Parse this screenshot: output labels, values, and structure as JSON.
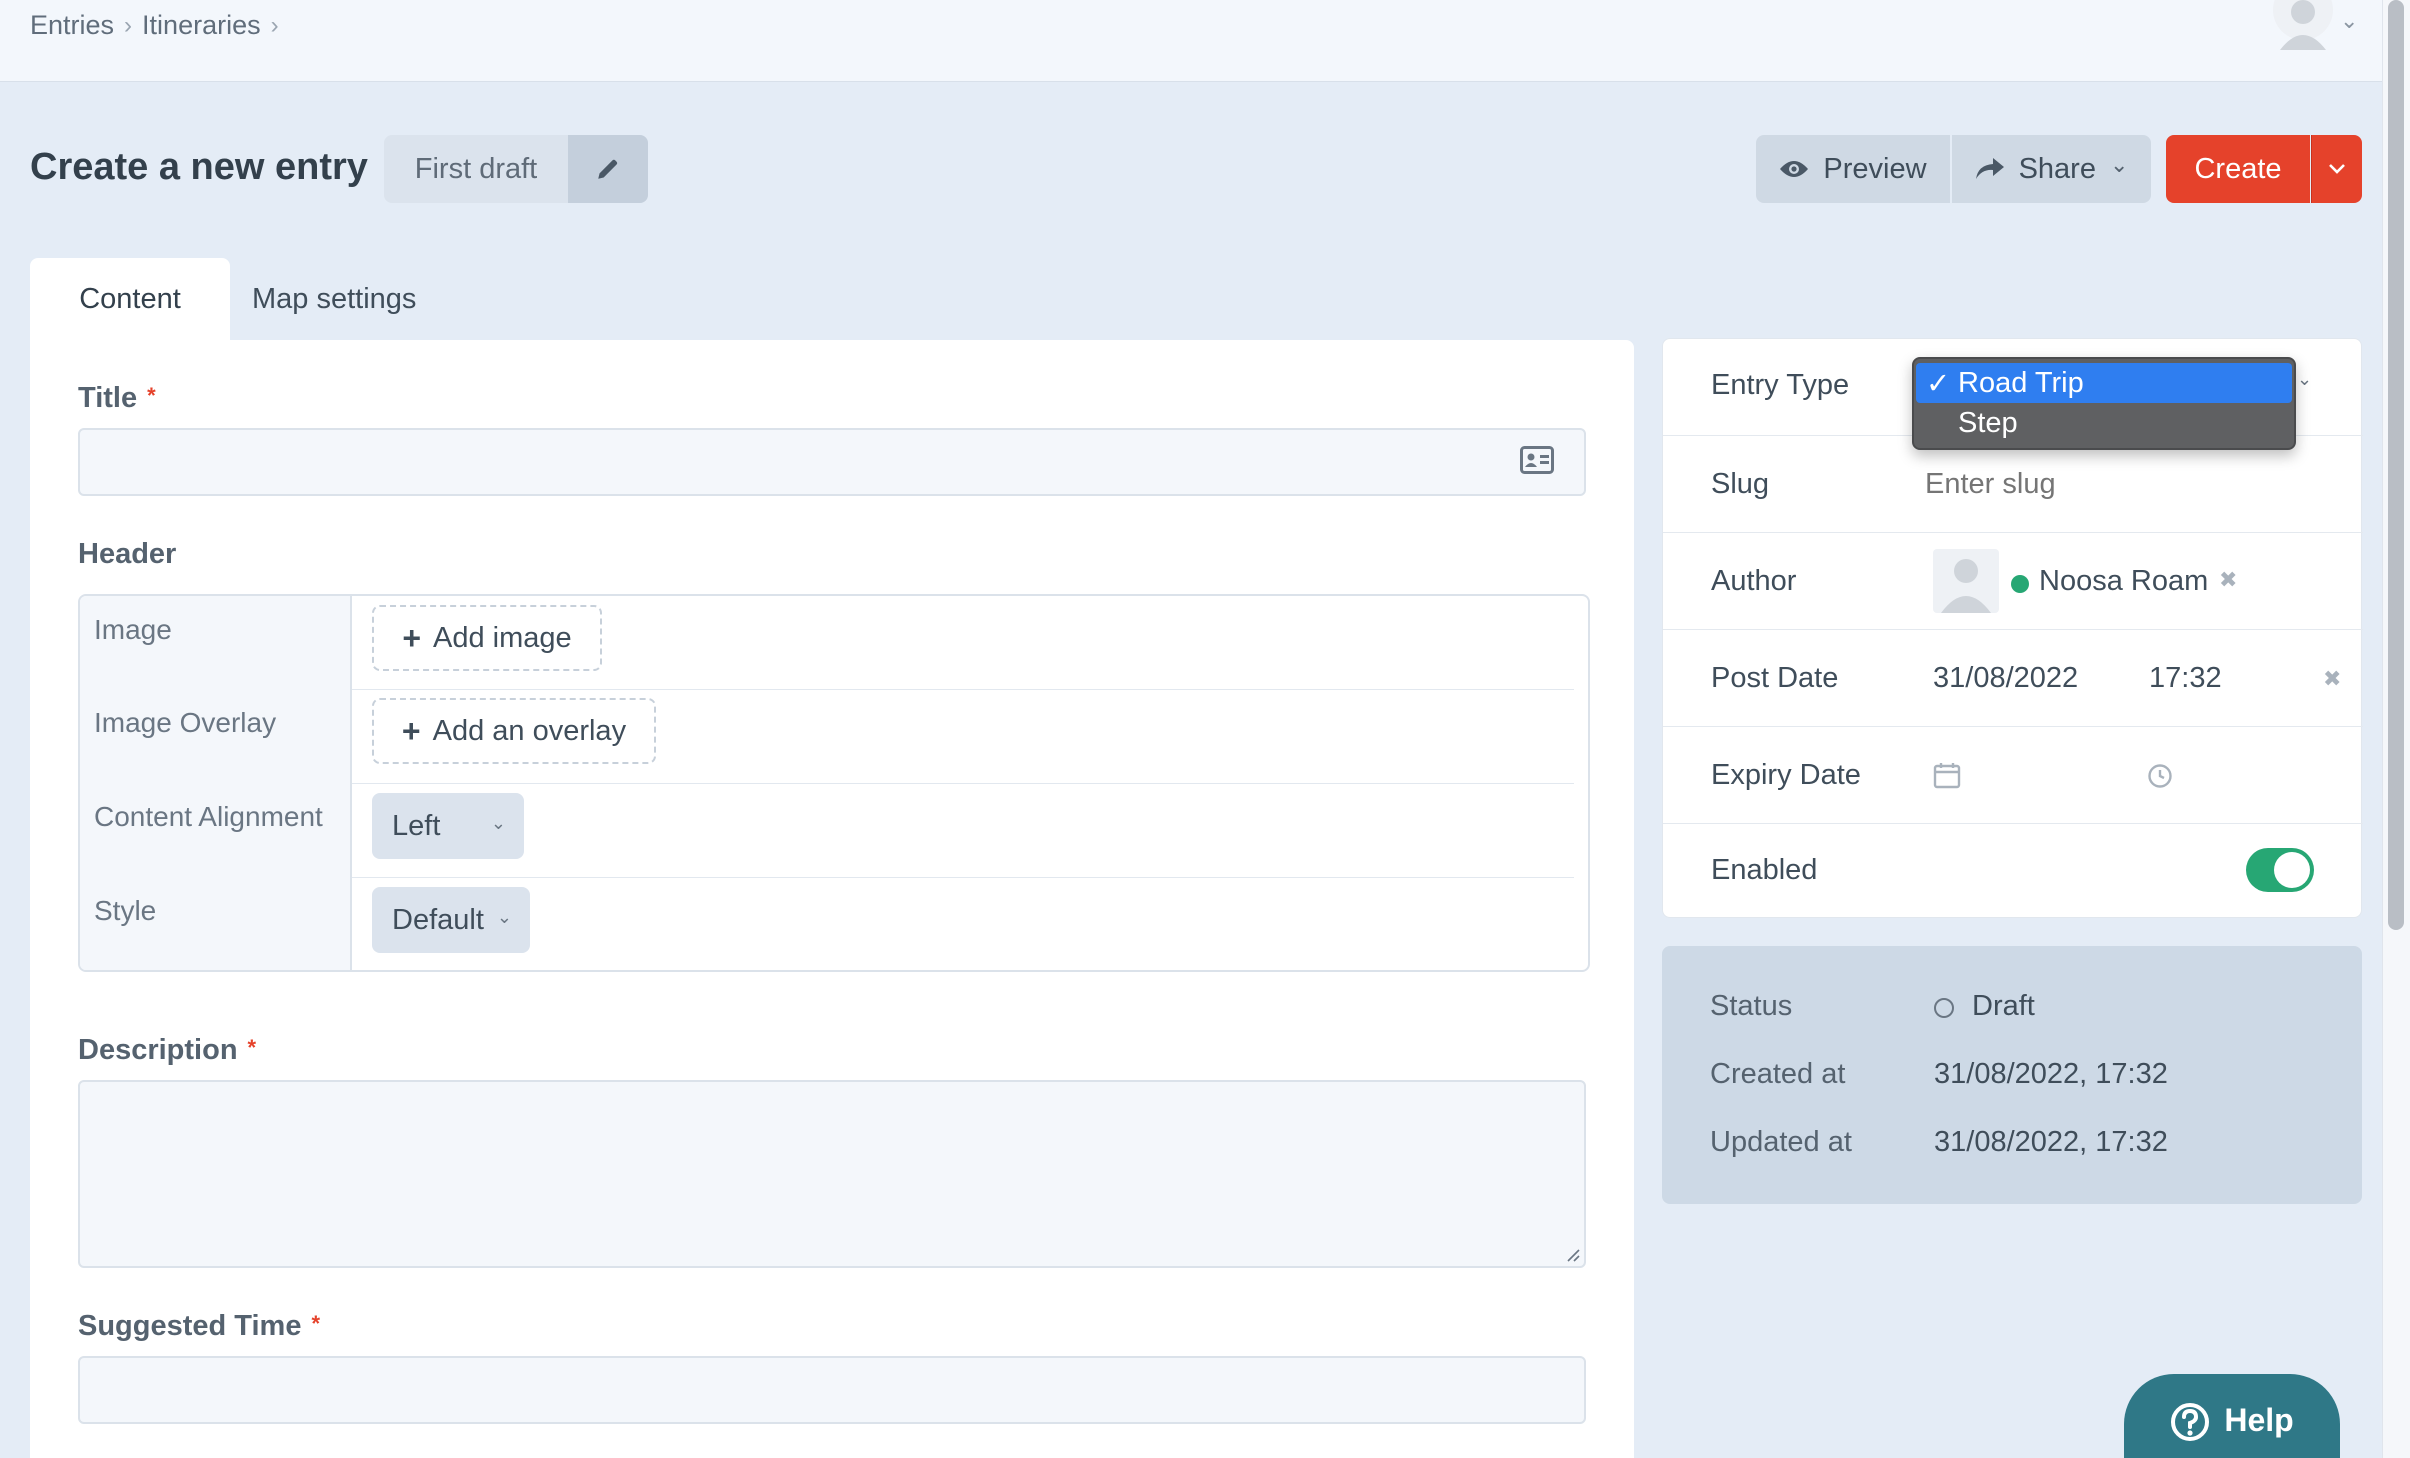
{
  "breadcrumb": [
    "Entries",
    "Itineraries"
  ],
  "page": {
    "title": "Create a new entry",
    "draft_name": "First draft"
  },
  "actions": {
    "preview": "Preview",
    "share": "Share",
    "create": "Create"
  },
  "tabs": [
    {
      "label": "Content",
      "active": true
    },
    {
      "label": "Map settings",
      "active": false
    }
  ],
  "fields": {
    "title": {
      "label": "Title",
      "required": "*",
      "value": ""
    },
    "header": {
      "label": "Header",
      "rows": [
        {
          "label": "Image",
          "control": "Add image"
        },
        {
          "label": "Image Overlay",
          "control": "Add an overlay"
        },
        {
          "label": "Content Alignment",
          "control": "Left"
        },
        {
          "label": "Style",
          "control": "Default"
        }
      ]
    },
    "description": {
      "label": "Description",
      "required": "*",
      "value": ""
    },
    "suggested_time": {
      "label": "Suggested Time",
      "required": "*",
      "value": ""
    }
  },
  "meta": {
    "entry_type": {
      "label": "Entry Type",
      "options": [
        {
          "label": "Road Trip",
          "selected": true,
          "check": "✓"
        },
        {
          "label": "Step",
          "selected": false
        }
      ]
    },
    "slug": {
      "label": "Slug",
      "placeholder": "Enter slug"
    },
    "author": {
      "label": "Author",
      "name": "Noosa Roam"
    },
    "post_date": {
      "label": "Post Date",
      "date": "31/08/2022",
      "time": "17:32"
    },
    "expiry_date": {
      "label": "Expiry Date"
    },
    "enabled": {
      "label": "Enabled",
      "on": true
    }
  },
  "status": {
    "status_label": "Status",
    "status_value": "Draft",
    "created_label": "Created at",
    "created_value": "31/08/2022, 17:32",
    "updated_label": "Updated at",
    "updated_value": "31/08/2022, 17:32"
  },
  "help": {
    "label": "Help"
  },
  "colors": {
    "primary_red": "#e5422b",
    "enabled_green": "#27a774",
    "help_teal": "#2f7887",
    "selected_blue": "#2f7ef0"
  }
}
